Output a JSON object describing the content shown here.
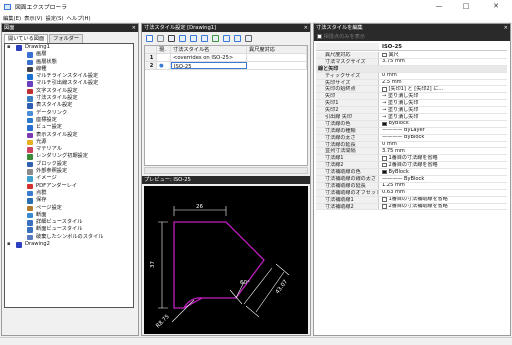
{
  "window": {
    "title": "図面エクスプローラ",
    "minimize": "—",
    "maximize": "□",
    "close": "✕"
  },
  "menu": [
    "編集(E)",
    "表示(V)",
    "設定(S)",
    "ヘルプ(H)"
  ],
  "left_pane": {
    "header": "図面",
    "close": "×",
    "tabs": [
      "開いている図面",
      "フォルダー"
    ],
    "tree": [
      {
        "label": "Drawing1",
        "icon": "drawing-icon",
        "color": "#2b3fbf",
        "level": 0,
        "toggle": "▪"
      },
      {
        "label": "画層",
        "icon": "layer-icon",
        "color": "#3b6fd0",
        "level": 1
      },
      {
        "label": "画層状態",
        "icon": "layer-state-icon",
        "color": "#3b6fd0",
        "level": 1
      },
      {
        "label": "線種",
        "icon": "linetype-icon",
        "color": "#444444",
        "level": 1
      },
      {
        "label": "マルチラインスタイル設定",
        "icon": "multiline-icon",
        "color": "#1a6fd0",
        "level": 1
      },
      {
        "label": "マルチ引出線スタイル設定",
        "icon": "mleader-icon",
        "color": "#6a3fc0",
        "level": 1
      },
      {
        "label": "文字スタイル設定",
        "icon": "text-style-icon",
        "color": "#c03030",
        "level": 1
      },
      {
        "label": "寸法スタイル設定",
        "icon": "dim-style-icon",
        "color": "#3a7fc0",
        "level": 1
      },
      {
        "label": "表スタイル設定",
        "icon": "table-style-icon",
        "color": "#2f5fb0",
        "level": 1
      },
      {
        "label": "データリンク",
        "icon": "datalink-icon",
        "color": "#4a8fd8",
        "level": 1
      },
      {
        "label": "座標設定",
        "icon": "ucs-icon",
        "color": "#2a7ad0",
        "level": 1
      },
      {
        "label": "ビュー設定",
        "icon": "view-icon",
        "color": "#2a6fd0",
        "level": 1
      },
      {
        "label": "表示スタイル設定",
        "icon": "visual-style-icon",
        "color": "#7a3ab0",
        "level": 1
      },
      {
        "label": "光源",
        "icon": "light-icon",
        "color": "#e8b020",
        "level": 1
      },
      {
        "label": "マテリアル",
        "icon": "material-icon",
        "color": "#d04060",
        "level": 1
      },
      {
        "label": "レンダリング初期設定",
        "icon": "render-icon",
        "color": "#3a8a3a",
        "level": 1
      },
      {
        "label": "ブロック設定",
        "icon": "block-icon",
        "color": "#3060b0",
        "level": 1
      },
      {
        "label": "外部参照設定",
        "icon": "xref-icon",
        "color": "#8a8a8a",
        "level": 1
      },
      {
        "label": "イメージ",
        "icon": "image-icon",
        "color": "#40a0d0",
        "level": 1
      },
      {
        "label": "PDFアンダーレイ",
        "icon": "pdf-icon",
        "color": "#d03030",
        "level": 1
      },
      {
        "label": "点群",
        "icon": "point-cloud-icon",
        "color": "#3a7ad0",
        "level": 1
      },
      {
        "label": "保存",
        "icon": "save-icon",
        "color": "#2a6fb0",
        "level": 1
      },
      {
        "label": "ページ設定",
        "icon": "page-setup-icon",
        "color": "#b07a30",
        "level": 1
      },
      {
        "label": "断面",
        "icon": "section-icon",
        "color": "#3a8ad0",
        "level": 1
      },
      {
        "label": "詳細ビュースタイル",
        "icon": "detail-view-icon",
        "color": "#3a6fc0",
        "level": 1
      },
      {
        "label": "断面ビュースタイル",
        "icon": "section-view-icon",
        "color": "#3a6fc0",
        "level": 1
      },
      {
        "label": "破棄したシンボルのスタイル",
        "icon": "symbol-style-icon",
        "color": "#5a7ac0",
        "level": 1
      },
      {
        "label": "Drawing2",
        "icon": "drawing-icon",
        "color": "#2b3fbf",
        "level": 0,
        "toggle": "▪"
      }
    ]
  },
  "mid_pane": {
    "header": "寸法スタイル設定 [Drawing1]",
    "close": "×",
    "toolbar_icons": [
      "new-icon",
      "delete-icon",
      "set-current-icon",
      "edit-icon",
      "copy-icon",
      "paste-icon",
      "refresh-icon",
      "export-icon",
      "list-view-icon",
      "detail-view-icon"
    ],
    "columns": [
      "",
      "現.",
      "寸法スタイル名",
      "異尺度対応"
    ],
    "rows": [
      {
        "num": "1",
        "current": "",
        "name": "<overrides on ISO-25>",
        "annotative": ""
      },
      {
        "num": "2",
        "current": "●",
        "name": "ISO-25",
        "annotative": ""
      }
    ],
    "preview_header": "プレビュー: ISO-25",
    "preview": {
      "dim_top": "26",
      "dim_left": "37",
      "dim_bottom": "R8.75",
      "dim_diag": "43.07",
      "dim_angle": "60°"
    }
  },
  "right_pane": {
    "header": "寸法スタイルを編集",
    "close": "×",
    "show_diff_label": "相違点のみを表示",
    "name_field": "ISO-25",
    "rows": [
      {
        "type": "row",
        "key": "異尺度対応",
        "value": "異尺",
        "swatch": "empty"
      },
      {
        "type": "row",
        "key": "寸法マスクサイズ",
        "value": "3.75 mm"
      },
      {
        "type": "section",
        "key": "線と矢印"
      },
      {
        "type": "row",
        "key": "ティックサイズ",
        "value": "0 mm"
      },
      {
        "type": "row",
        "key": "矢印サイズ",
        "value": "2.5 mm"
      },
      {
        "type": "row",
        "key": "矢印の始終点",
        "value": "[矢印1] と [矢印2] に...",
        "swatch": "empty"
      },
      {
        "type": "row",
        "key": "矢印",
        "value": "→ 塗り潰し矢印"
      },
      {
        "type": "row",
        "key": "矢印1",
        "value": "→ 塗り潰し矢印"
      },
      {
        "type": "row",
        "key": "矢印2",
        "value": "→ 塗り潰し矢印"
      },
      {
        "type": "row",
        "key": "引出線 矢印",
        "value": "→ 塗り潰し矢印"
      },
      {
        "type": "row",
        "key": "寸法線の色",
        "value": "ByBlock",
        "swatch": "fill"
      },
      {
        "type": "row",
        "key": "寸法線の種類",
        "value": "———— ByLayer"
      },
      {
        "type": "row",
        "key": "寸法線の太さ",
        "value": "———— ByBlock"
      },
      {
        "type": "row",
        "key": "寸法線の延長",
        "value": "0 mm"
      },
      {
        "type": "row",
        "key": "並列寸法間隔",
        "value": "3.75 mm"
      },
      {
        "type": "row",
        "key": "寸法線1",
        "value": "1番目の寸法線を省略",
        "swatch": "empty"
      },
      {
        "type": "row",
        "key": "寸法線2",
        "value": "2番目の寸法線を省略",
        "swatch": "empty"
      },
      {
        "type": "row",
        "key": "寸法補助線の色",
        "value": "ByBlock",
        "swatch": "fill"
      },
      {
        "type": "row",
        "key": "寸法補助線の線の太さ",
        "value": "———— ByBlock"
      },
      {
        "type": "row",
        "key": "寸法補助線の延長",
        "value": "1.25 mm"
      },
      {
        "type": "row",
        "key": "寸法補助線のオフセット",
        "value": "0.63 mm"
      },
      {
        "type": "row",
        "key": "寸法補助線1",
        "value": "1番目の寸法補助線を省略",
        "swatch": "empty"
      },
      {
        "type": "row",
        "key": "寸法補助線2",
        "value": "2番目の寸法補助線を省略",
        "swatch": "empty"
      }
    ]
  },
  "colors": {
    "header_bg": "#2a2a2a",
    "preview_bg": "#000000",
    "preview_stroke": "#c020c0",
    "accent": "#3a7bd5"
  }
}
